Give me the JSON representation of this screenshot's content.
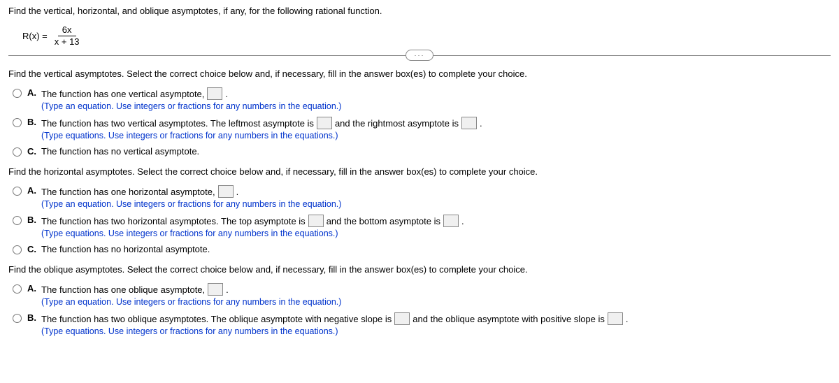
{
  "intro": "Find the vertical, horizontal, and oblique asymptotes, if any, for the following rational function.",
  "equation": {
    "lhs": "R(x) =",
    "num": "6x",
    "den": "x + 13"
  },
  "more_label": "···",
  "sections": {
    "vertical": {
      "prompt": "Find the vertical asymptotes. Select the correct choice below and, if necessary, fill in the answer box(es) to complete your choice.",
      "A": {
        "text": "The function has one vertical asymptote,",
        "hint": "(Type an equation. Use integers or fractions for any numbers in the equation.)"
      },
      "B": {
        "pre": "The function has two vertical asymptotes. The leftmost asymptote is",
        "mid": "and the rightmost asymptote is",
        "hint": "(Type equations. Use integers or fractions for any numbers in the equations.)"
      },
      "C": {
        "text": "The function has no vertical asymptote."
      }
    },
    "horizontal": {
      "prompt": "Find the horizontal asymptotes. Select the correct choice below and, if necessary, fill in the answer box(es) to complete your choice.",
      "A": {
        "text": "The function has one horizontal asymptote,",
        "hint": "(Type an equation. Use integers or fractions for any numbers in the equation.)"
      },
      "B": {
        "pre": "The function has two horizontal asymptotes. The top asymptote is",
        "mid": "and the bottom asymptote is",
        "hint": "(Type equations. Use integers or fractions for any numbers in the equations.)"
      },
      "C": {
        "text": "The function has no horizontal asymptote."
      }
    },
    "oblique": {
      "prompt": "Find the oblique asymptotes. Select the correct choice below and, if necessary, fill in the answer box(es) to complete your choice.",
      "A": {
        "text": "The function has one oblique asymptote,",
        "hint": "(Type an equation. Use integers or fractions for any numbers in the equation.)"
      },
      "B": {
        "pre": "The function has two oblique asymptotes. The oblique asymptote with negative slope is",
        "mid": "and the oblique asymptote with positive slope is",
        "hint": "(Type equations. Use integers or fractions for any numbers in the equations.)"
      }
    }
  },
  "letters": {
    "A": "A.",
    "B": "B.",
    "C": "C."
  },
  "period": "."
}
